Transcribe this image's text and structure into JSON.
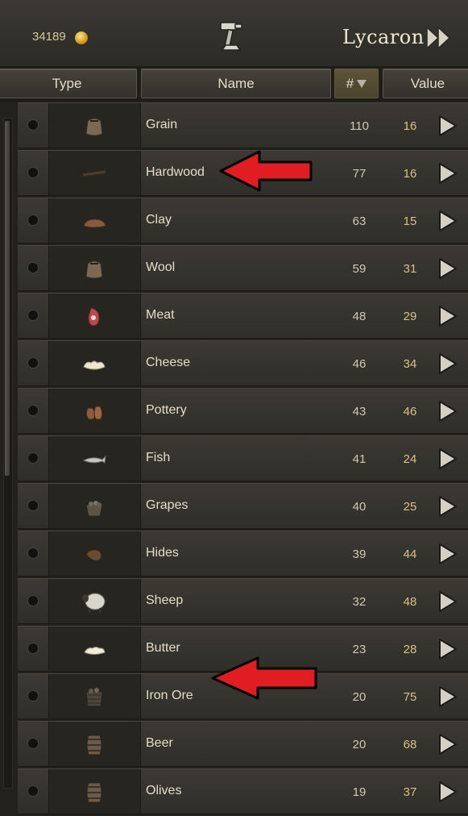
{
  "topbar": {
    "gold": "34189",
    "town_name": "Lycaron"
  },
  "columns": {
    "type": "Type",
    "name": "Name",
    "count": "#",
    "value": "Value"
  },
  "items": [
    {
      "name": "Grain",
      "count": "110",
      "value": "16",
      "icon": "sack-icon"
    },
    {
      "name": "Hardwood",
      "count": "77",
      "value": "16",
      "icon": "wood-icon"
    },
    {
      "name": "Clay",
      "count": "63",
      "value": "15",
      "icon": "clay-icon"
    },
    {
      "name": "Wool",
      "count": "59",
      "value": "31",
      "icon": "sack-icon"
    },
    {
      "name": "Meat",
      "count": "48",
      "value": "29",
      "icon": "meat-icon"
    },
    {
      "name": "Cheese",
      "count": "46",
      "value": "34",
      "icon": "cheese-icon"
    },
    {
      "name": "Pottery",
      "count": "43",
      "value": "46",
      "icon": "pottery-icon"
    },
    {
      "name": "Fish",
      "count": "41",
      "value": "24",
      "icon": "fish-icon"
    },
    {
      "name": "Grapes",
      "count": "40",
      "value": "25",
      "icon": "basket-icon"
    },
    {
      "name": "Hides",
      "count": "39",
      "value": "44",
      "icon": "hides-icon"
    },
    {
      "name": "Sheep",
      "count": "32",
      "value": "48",
      "icon": "sheep-icon"
    },
    {
      "name": "Butter",
      "count": "23",
      "value": "28",
      "icon": "butter-icon"
    },
    {
      "name": "Iron Ore",
      "count": "20",
      "value": "75",
      "icon": "ore-basket-icon"
    },
    {
      "name": "Beer",
      "count": "20",
      "value": "68",
      "icon": "barrel-icon"
    },
    {
      "name": "Olives",
      "count": "19",
      "value": "37",
      "icon": "barrel-icon"
    }
  ],
  "colors": {
    "arrow": "#e11d24",
    "value_text": "#d8c184",
    "coin": "#d39a1c"
  }
}
